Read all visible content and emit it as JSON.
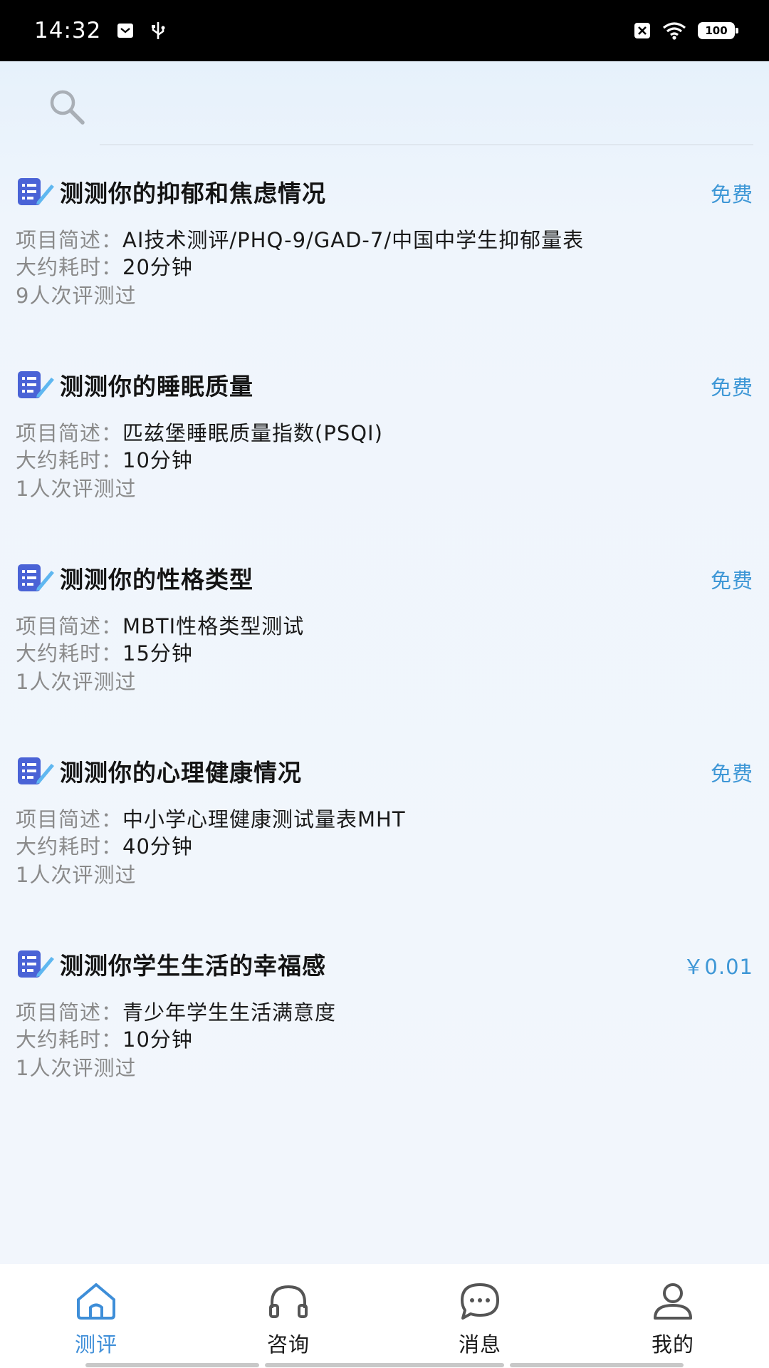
{
  "status_bar": {
    "time": "14:32",
    "battery": "100",
    "icons": [
      "mail-icon",
      "usb-icon",
      "no-sim-icon",
      "wifi-icon",
      "battery-icon"
    ]
  },
  "search": {
    "placeholder": ""
  },
  "items": [
    {
      "title": "测测你的抑郁和焦虑情况",
      "price": "免费",
      "desc_label": "项目简述：",
      "desc": "AI技术测评/PHQ-9/GAD-7/中国中学生抑郁量表",
      "time_label": "大约耗时：",
      "time": "20分钟",
      "count": "9人次评测过"
    },
    {
      "title": "测测你的睡眠质量",
      "price": "免费",
      "desc_label": "项目简述：",
      "desc": "匹兹堡睡眠质量指数(PSQI)",
      "time_label": "大约耗时：",
      "time": "10分钟",
      "count": "1人次评测过"
    },
    {
      "title": "测测你的性格类型",
      "price": "免费",
      "desc_label": "项目简述：",
      "desc": "MBTI性格类型测试",
      "time_label": "大约耗时：",
      "time": "15分钟",
      "count": "1人次评测过"
    },
    {
      "title": "测测你的心理健康情况",
      "price": "免费",
      "desc_label": "项目简述：",
      "desc": "中小学心理健康测试量表MHT",
      "time_label": "大约耗时：",
      "time": "40分钟",
      "count": "1人次评测过"
    },
    {
      "title": "测测你学生生活的幸福感",
      "price": "￥0.01",
      "desc_label": "项目简述：",
      "desc": "青少年学生生活满意度",
      "time_label": "大约耗时：",
      "time": "10分钟",
      "count": "1人次评测过"
    }
  ],
  "tabs": [
    {
      "label": "测评",
      "icon": "home-icon",
      "active": true
    },
    {
      "label": "咨询",
      "icon": "headphones-icon",
      "active": false
    },
    {
      "label": "消息",
      "icon": "chat-bubble-icon",
      "active": false
    },
    {
      "label": "我的",
      "icon": "person-icon",
      "active": false
    }
  ],
  "colors": {
    "accent": "#3e8ed8",
    "price": "#3e97d6",
    "muted_text": "#8a8a8a",
    "status_bar": "#000000"
  }
}
